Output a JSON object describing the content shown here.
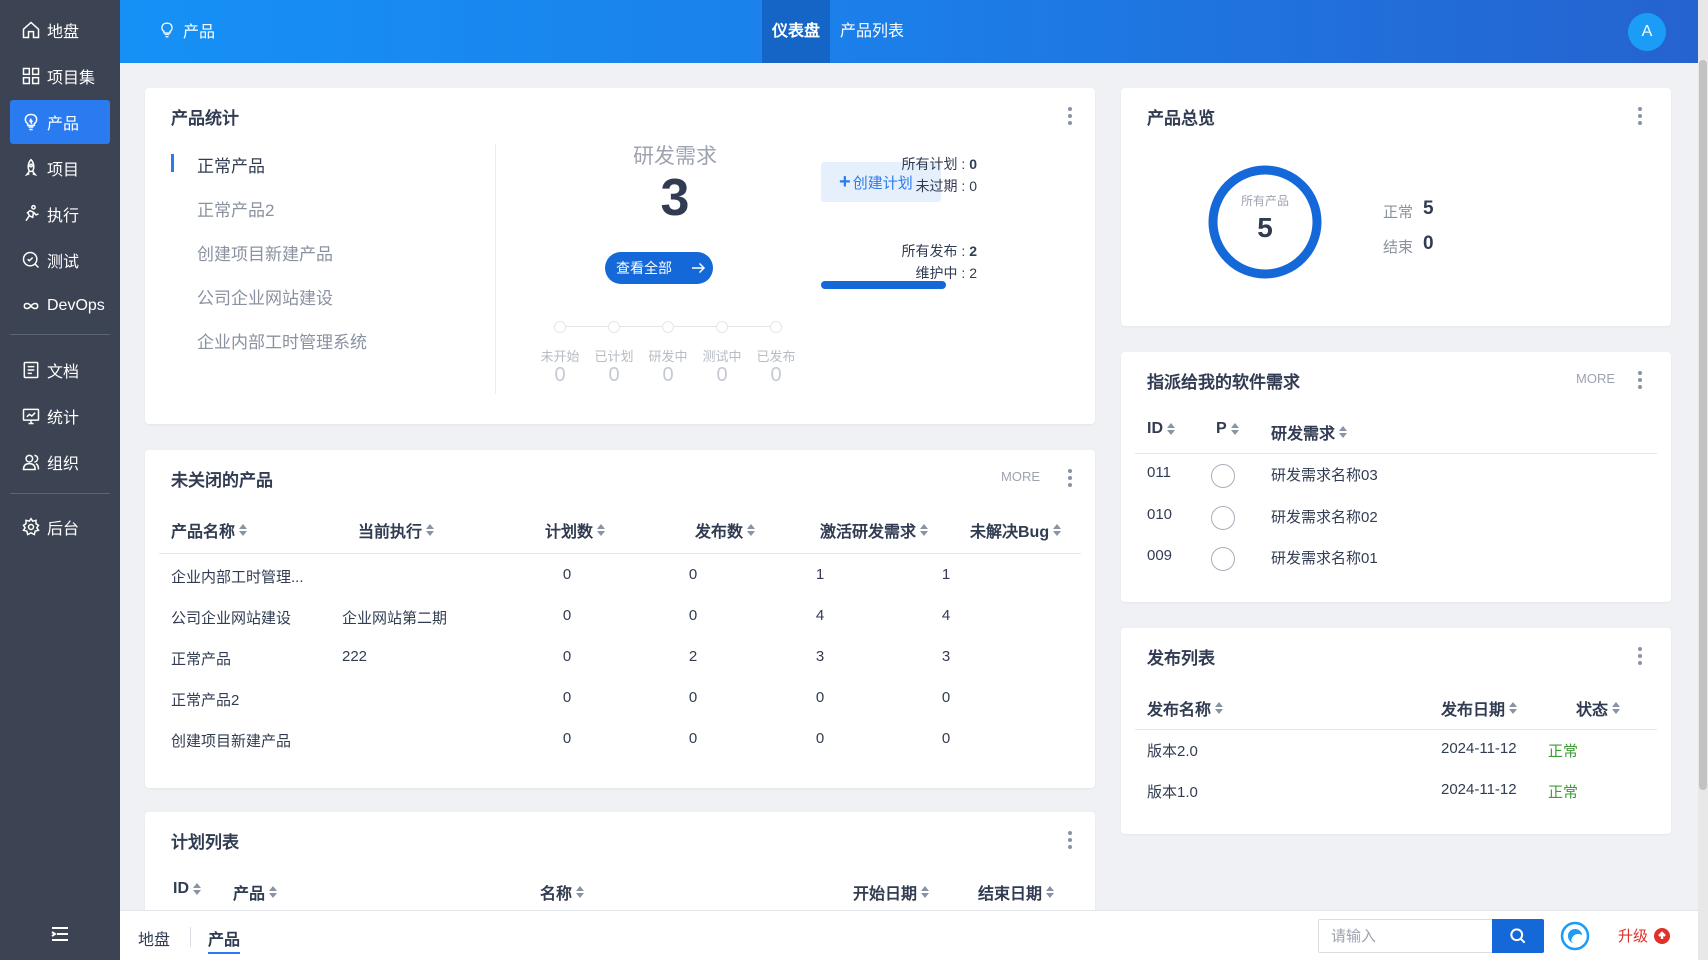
{
  "sidebar": {
    "items": [
      {
        "label": "地盘",
        "icon": "home-icon"
      },
      {
        "label": "项目集",
        "icon": "grid-icon"
      },
      {
        "label": "产品",
        "icon": "bulb-icon",
        "active": true
      },
      {
        "label": "项目",
        "icon": "rocket-icon"
      },
      {
        "label": "执行",
        "icon": "run-icon"
      },
      {
        "label": "测试",
        "icon": "test-icon"
      },
      {
        "label": "DevOps",
        "icon": "infinity-icon"
      },
      {
        "label": "文档",
        "icon": "doc-icon"
      },
      {
        "label": "统计",
        "icon": "chart-monitor-icon"
      },
      {
        "label": "组织",
        "icon": "people-icon"
      },
      {
        "label": "后台",
        "icon": "gear-icon"
      }
    ]
  },
  "header": {
    "crumb": "产品",
    "tabs": [
      {
        "label": "仪表盘",
        "active": true
      },
      {
        "label": "产品列表"
      }
    ],
    "avatar": "A"
  },
  "product_stats": {
    "title": "产品统计",
    "products": [
      "正常产品",
      "正常产品2",
      "创建项目新建产品",
      "公司企业网站建设",
      "企业内部工时管理系统"
    ],
    "story_label": "研发需求",
    "story_count": "3",
    "view_all": "查看全部",
    "steps": [
      {
        "label": "未开始",
        "value": "0"
      },
      {
        "label": "已计划",
        "value": "0"
      },
      {
        "label": "研发中",
        "value": "0"
      },
      {
        "label": "测试中",
        "value": "0"
      },
      {
        "label": "已发布",
        "value": "0"
      }
    ],
    "create_plan": "创建计划",
    "all_plans_label": "所有计划",
    "all_plans_value": "0",
    "unexpired_label": "未过期",
    "unexpired_value": "0",
    "all_releases_label": "所有发布",
    "all_releases_value": "2",
    "maintaining_label": "维护中",
    "maintaining_value": "2",
    "release_progress": 1.0
  },
  "unclosed_products": {
    "title": "未关闭的产品",
    "more": "MORE",
    "columns": [
      "产品名称",
      "当前执行",
      "计划数",
      "发布数",
      "激活研发需求",
      "未解决Bug"
    ],
    "rows": [
      [
        "企业内部工时管理...",
        "",
        "0",
        "0",
        "1",
        "1"
      ],
      [
        "公司企业网站建设",
        "企业网站第二期",
        "0",
        "0",
        "4",
        "4"
      ],
      [
        "正常产品",
        "222",
        "0",
        "2",
        "3",
        "3"
      ],
      [
        "正常产品2",
        "",
        "0",
        "0",
        "0",
        "0"
      ],
      [
        "创建项目新建产品",
        "",
        "0",
        "0",
        "0",
        "0"
      ]
    ]
  },
  "plan_list": {
    "title": "计划列表",
    "columns": [
      "ID",
      "产品",
      "名称",
      "开始日期",
      "结束日期"
    ]
  },
  "overview": {
    "title": "产品总览",
    "total_label": "所有产品",
    "total": "5",
    "normal_label": "正常",
    "normal": "5",
    "closed_label": "结束",
    "closed": "0",
    "ring_color": "#1468d8"
  },
  "assigned_stories": {
    "title": "指派给我的软件需求",
    "more": "MORE",
    "columns": [
      "ID",
      "P",
      "研发需求"
    ],
    "rows": [
      [
        "011",
        "",
        "研发需求名称03"
      ],
      [
        "010",
        "",
        "研发需求名称02"
      ],
      [
        "009",
        "",
        "研发需求名称01"
      ]
    ]
  },
  "releases": {
    "title": "发布列表",
    "columns": [
      "发布名称",
      "发布日期",
      "状态"
    ],
    "rows": [
      [
        "版本2.0",
        "2024-11-12",
        "正常"
      ],
      [
        "版本1.0",
        "2024-11-12",
        "正常"
      ]
    ],
    "status_color": "#3e9b36"
  },
  "bottombar": {
    "tabs": [
      "地盘",
      "产品"
    ],
    "search_placeholder": "请输入",
    "upgrade": "升级"
  }
}
